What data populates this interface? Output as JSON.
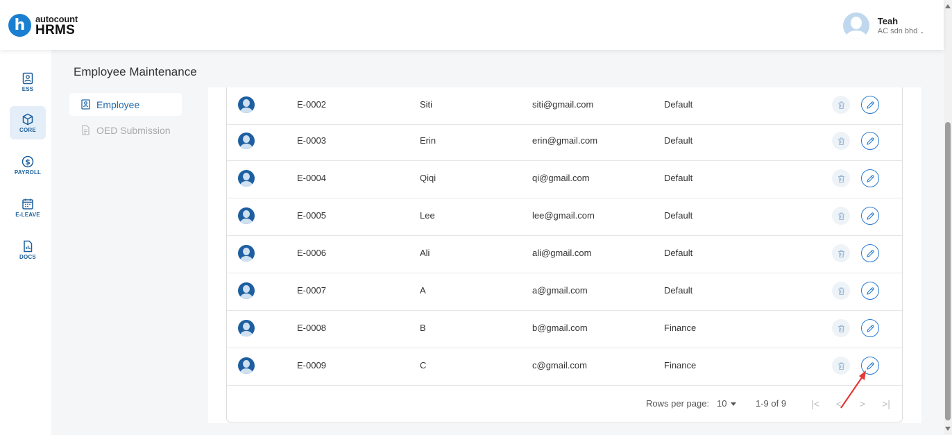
{
  "app": {
    "logo_circle": "h",
    "logo_top": "autocount",
    "logo_bottom": "HRMS",
    "colors": {
      "brand": "#1a7fd0",
      "accent": "#1c66a8",
      "arrow": "#e53935"
    }
  },
  "user": {
    "name": "Teah",
    "company": "AC sdn bhd"
  },
  "sidebar": {
    "items": [
      {
        "label": "ESS",
        "icon": "ess-icon"
      },
      {
        "label": "CORE",
        "icon": "core-icon"
      },
      {
        "label": "PAYROLL",
        "icon": "payroll-icon"
      },
      {
        "label": "E-LEAVE",
        "icon": "calendar-icon"
      },
      {
        "label": "DOCS",
        "icon": "docs-icon"
      }
    ]
  },
  "page": {
    "title": "Employee Maintenance"
  },
  "subnav": {
    "items": [
      {
        "label": "Employee",
        "icon": "employee-doc-icon"
      },
      {
        "label": "OED Submission",
        "icon": "oed-doc-icon"
      }
    ]
  },
  "table": {
    "rows": [
      {
        "code": "E-0002",
        "name": "Siti",
        "email": "siti@gmail.com",
        "group": "Default"
      },
      {
        "code": "E-0003",
        "name": "Erin",
        "email": "erin@gmail.com",
        "group": "Default"
      },
      {
        "code": "E-0004",
        "name": "Qiqi",
        "email": "qi@gmail.com",
        "group": "Default"
      },
      {
        "code": "E-0005",
        "name": "Lee",
        "email": "lee@gmail.com",
        "group": "Default"
      },
      {
        "code": "E-0006",
        "name": "Ali",
        "email": "ali@gmail.com",
        "group": "Default"
      },
      {
        "code": "E-0007",
        "name": "A",
        "email": "a@gmail.com",
        "group": "Default"
      },
      {
        "code": "E-0008",
        "name": "B",
        "email": "b@gmail.com",
        "group": "Finance"
      },
      {
        "code": "E-0009",
        "name": "C",
        "email": "c@gmail.com",
        "group": "Finance"
      }
    ]
  },
  "pager": {
    "rows_per_page_label": "Rows per page:",
    "rows_per_page_value": "10",
    "range": "1-9 of 9",
    "first": "|<",
    "prev": "<",
    "next": ">",
    "last": ">|"
  }
}
